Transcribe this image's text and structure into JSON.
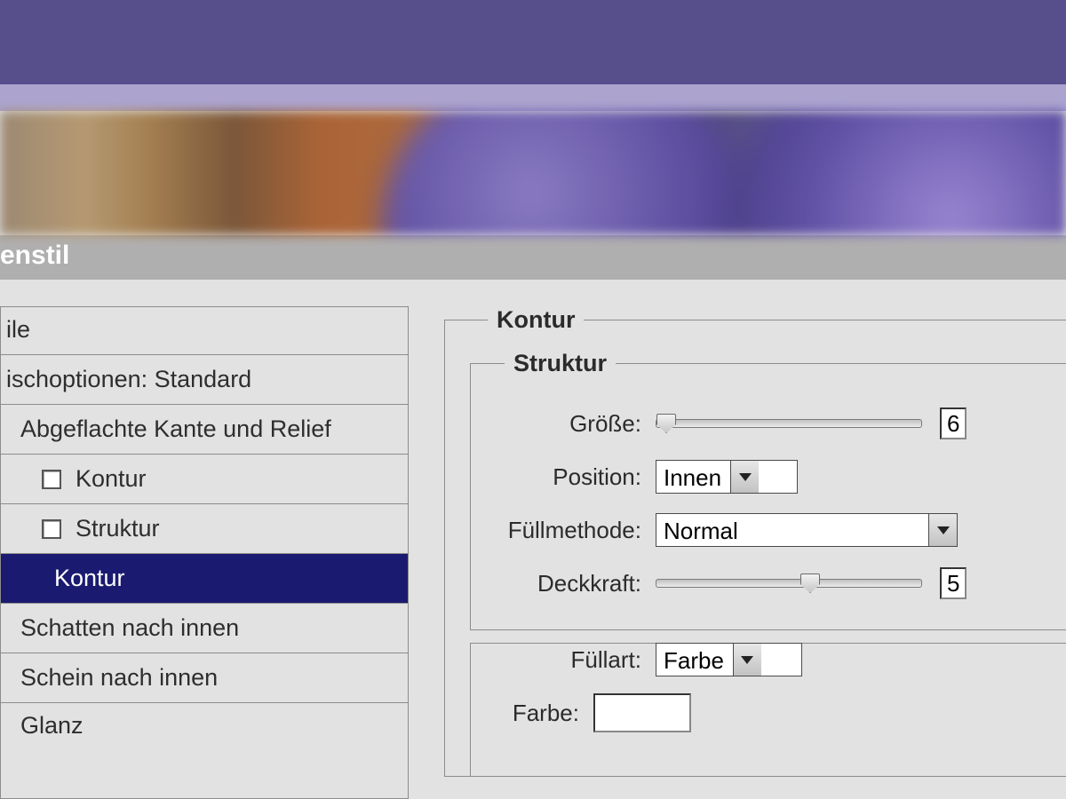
{
  "dialog": {
    "title": "enstil"
  },
  "styles": {
    "header": "ile",
    "items": [
      {
        "label": "ischoptionen: Standard",
        "indent": 0,
        "checkbox": false,
        "selected": false
      },
      {
        "label": "Abgeflachte Kante und Relief",
        "indent": 1,
        "checkbox": false,
        "selected": false
      },
      {
        "label": "Kontur",
        "indent": 2,
        "checkbox": true,
        "selected": false
      },
      {
        "label": "Struktur",
        "indent": 2,
        "checkbox": true,
        "selected": false
      },
      {
        "label": "Kontur",
        "indent": 1,
        "checkbox": false,
        "selected": true
      },
      {
        "label": "Schatten nach innen",
        "indent": 1,
        "checkbox": false,
        "selected": false
      },
      {
        "label": "Schein nach innen",
        "indent": 1,
        "checkbox": false,
        "selected": false
      },
      {
        "label": "Glanz",
        "indent": 1,
        "checkbox": false,
        "selected": false
      }
    ]
  },
  "panel": {
    "outer_legend": "Kontur",
    "struct_legend": "Struktur",
    "size_label": "Größe:",
    "size_value_fragment": "6",
    "size_percent": 4,
    "position_label": "Position:",
    "position_value": "Innen",
    "fillmethod_label": "Füllmethode:",
    "fillmethod_value": "Normal",
    "opacity_label": "Deckkraft:",
    "opacity_value_fragment": "5",
    "opacity_percent": 58,
    "filltype_label": "Füllart:",
    "filltype_value": "Farbe",
    "color_label": "Farbe:",
    "color_hex": "#ffffff"
  }
}
